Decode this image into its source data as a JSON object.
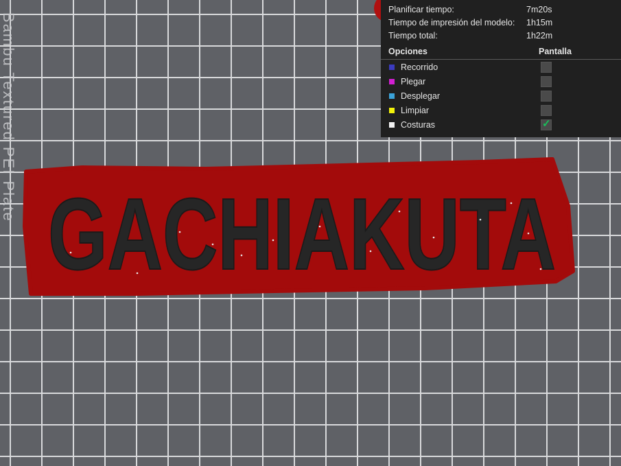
{
  "plate_label": "Bambu Textured PEI Plate",
  "model_text": "GACHIAKUTA",
  "stats": [
    {
      "label": "Planificar tiempo:",
      "value": "7m20s"
    },
    {
      "label": "Tiempo de impresión del modelo:",
      "value": "1h15m"
    },
    {
      "label": "Tiempo total:",
      "value": "1h22m"
    }
  ],
  "options_header": {
    "col1": "Opciones",
    "col2": "Pantalla"
  },
  "options": [
    {
      "label": "Recorrido",
      "color": "#3b3bbf",
      "checked": false
    },
    {
      "label": "Plegar",
      "color": "#d11fd1",
      "checked": false
    },
    {
      "label": "Desplegar",
      "color": "#3ba3d9",
      "checked": false
    },
    {
      "label": "Limpiar",
      "color": "#f2f20a",
      "checked": false
    },
    {
      "label": "Costuras",
      "color": "#f2f2f2",
      "checked": true
    }
  ],
  "colors": {
    "outline": "#a30b0b",
    "letters": "#262626",
    "plate": "#5f6166",
    "panel": "#202020"
  }
}
